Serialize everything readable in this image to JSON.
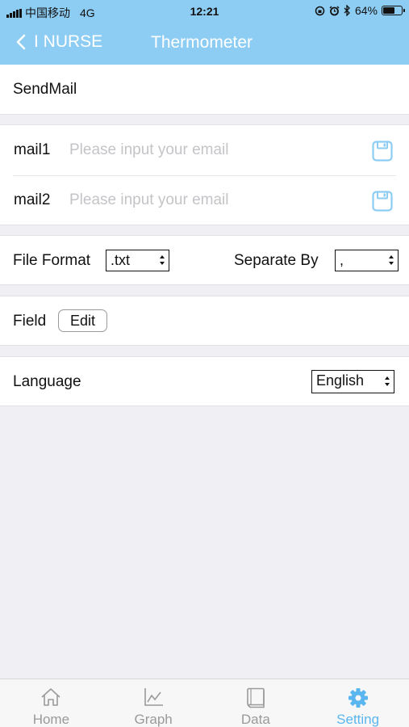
{
  "status_bar": {
    "carrier": "中国移动",
    "network": "4G",
    "time": "12:21",
    "battery": "64%",
    "battery_level": 0.64
  },
  "nav": {
    "back_label": "I NURSE",
    "title": "Thermometer"
  },
  "send_mail": {
    "title": "SendMail"
  },
  "mails": [
    {
      "label": "mail1",
      "placeholder": "Please input your email",
      "value": ""
    },
    {
      "label": "mail2",
      "placeholder": "Please input your email",
      "value": ""
    }
  ],
  "file": {
    "format_label": "File Format",
    "format_value": ".txt",
    "separate_label": "Separate By",
    "separate_value": ","
  },
  "field": {
    "label": "Field",
    "edit_label": "Edit"
  },
  "language": {
    "label": "Language",
    "value": "English"
  },
  "tabs": [
    {
      "label": "Home",
      "icon": "home-icon",
      "active": false
    },
    {
      "label": "Graph",
      "icon": "graph-icon",
      "active": false
    },
    {
      "label": "Data",
      "icon": "book-icon",
      "active": false
    },
    {
      "label": "Setting",
      "icon": "gear-icon",
      "active": true
    }
  ],
  "colors": {
    "header": "#8ecdf3",
    "accent": "#5bb6ef",
    "background": "#efeff4"
  }
}
